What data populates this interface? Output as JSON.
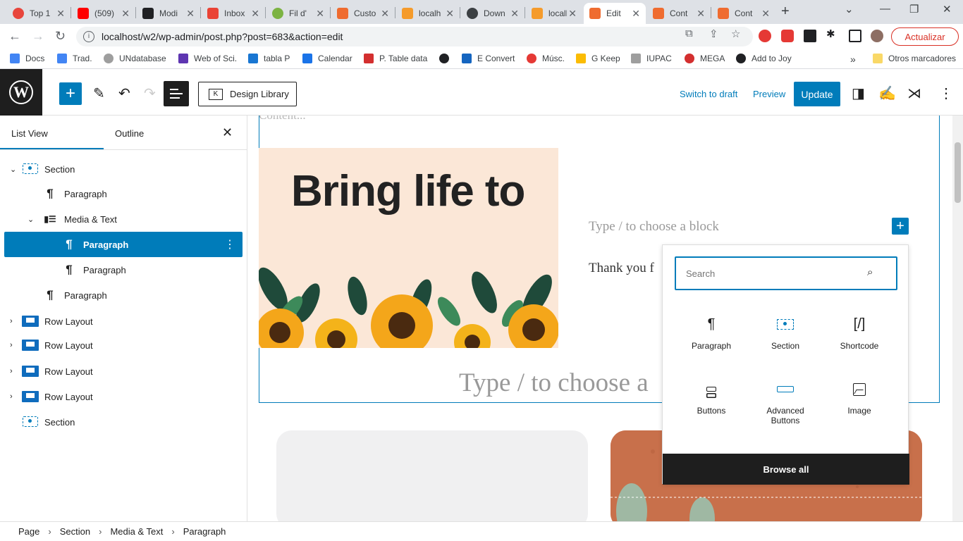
{
  "browser": {
    "tabs": [
      {
        "title": "Top 1",
        "color": "#e8453c"
      },
      {
        "title": "(509)",
        "color": "#ff0000"
      },
      {
        "title": "Modi",
        "color": "#202124"
      },
      {
        "title": "Inbox",
        "color": "#ea4335"
      },
      {
        "title": "Fil d'",
        "color": "#7cb342"
      },
      {
        "title": "Custo",
        "color": "#ef6c30"
      },
      {
        "title": "localh",
        "color": "#f59b2b"
      },
      {
        "title": "Down",
        "color": "#3c4043"
      },
      {
        "title": "localh",
        "color": "#f59b2b"
      },
      {
        "title": "Edit",
        "color": "#ef6c30"
      },
      {
        "title": "Cont",
        "color": "#ef6c30"
      },
      {
        "title": "Cont",
        "color": "#ef6c30"
      }
    ],
    "url": "localhost/w2/wp-admin/post.php?post=683&action=edit",
    "update_label": "Actualizar",
    "bookmarks": [
      {
        "label": "Docs",
        "color": "#4285f4"
      },
      {
        "label": "Trad.",
        "color": "#4285f4"
      },
      {
        "label": "UNdatabase",
        "color": "#9e9e9e"
      },
      {
        "label": "Web of Sci.",
        "color": "#5e35b1"
      },
      {
        "label": "tabla P",
        "color": "#1976d2"
      },
      {
        "label": "Calendar",
        "color": "#1a73e8"
      },
      {
        "label": "P. Table data",
        "color": "#d32f2f"
      },
      {
        "label": "",
        "color": "#202124"
      },
      {
        "label": "E Convert",
        "color": "#1565c0"
      },
      {
        "label": "Músc.",
        "color": "#e53935"
      },
      {
        "label": "G Keep",
        "color": "#fbbc04"
      },
      {
        "label": "IUPAC",
        "color": "#9e9e9e"
      },
      {
        "label": "MEGA",
        "color": "#d32f2f"
      },
      {
        "label": "Add to Joy",
        "color": "#202124"
      }
    ],
    "other_bookmarks": "Otros marcadores"
  },
  "toolbar": {
    "design_library": "Design Library",
    "switch_to_draft": "Switch to draft",
    "preview": "Preview",
    "update": "Update"
  },
  "sidebar": {
    "tabs": [
      "List View",
      "Outline"
    ],
    "items": [
      {
        "label": "Section",
        "icon": "section-icon"
      },
      {
        "label": "Paragraph",
        "icon": "paragraph-icon"
      },
      {
        "label": "Media & Text",
        "icon": "media-text-icon"
      },
      {
        "label": "Paragraph",
        "icon": "paragraph-icon",
        "selected": true
      },
      {
        "label": "Paragraph",
        "icon": "paragraph-icon"
      },
      {
        "label": "Paragraph",
        "icon": "paragraph-icon"
      },
      {
        "label": "Row Layout",
        "icon": "row-layout-icon"
      },
      {
        "label": "Row Layout",
        "icon": "row-layout-icon"
      },
      {
        "label": "Row Layout",
        "icon": "row-layout-icon"
      },
      {
        "label": "Row Layout",
        "icon": "row-layout-icon"
      },
      {
        "label": "Section",
        "icon": "section-icon"
      }
    ]
  },
  "editor": {
    "content_placeholder": "Content...",
    "block_placeholder": "Type / to choose a block",
    "thank_you_text": "Thank you f",
    "big_placeholder": "Type / to choose a",
    "card_title": "Bring life to"
  },
  "inserter": {
    "search_placeholder": "Search",
    "blocks": [
      {
        "label": "Paragraph",
        "icon": "¶"
      },
      {
        "label": "Section",
        "icon": "section"
      },
      {
        "label": "Shortcode",
        "icon": "[/]"
      },
      {
        "label": "Buttons",
        "icon": "buttons"
      },
      {
        "label": "Advanced\nButtons",
        "icon": "adv-buttons"
      },
      {
        "label": "Image",
        "icon": "image"
      }
    ],
    "browse_all": "Browse all"
  },
  "footer_breadcrumb": [
    "Page",
    "Section",
    "Media & Text",
    "Paragraph"
  ],
  "colors": {
    "accent": "#007cba",
    "dark": "#1e1e1e"
  }
}
